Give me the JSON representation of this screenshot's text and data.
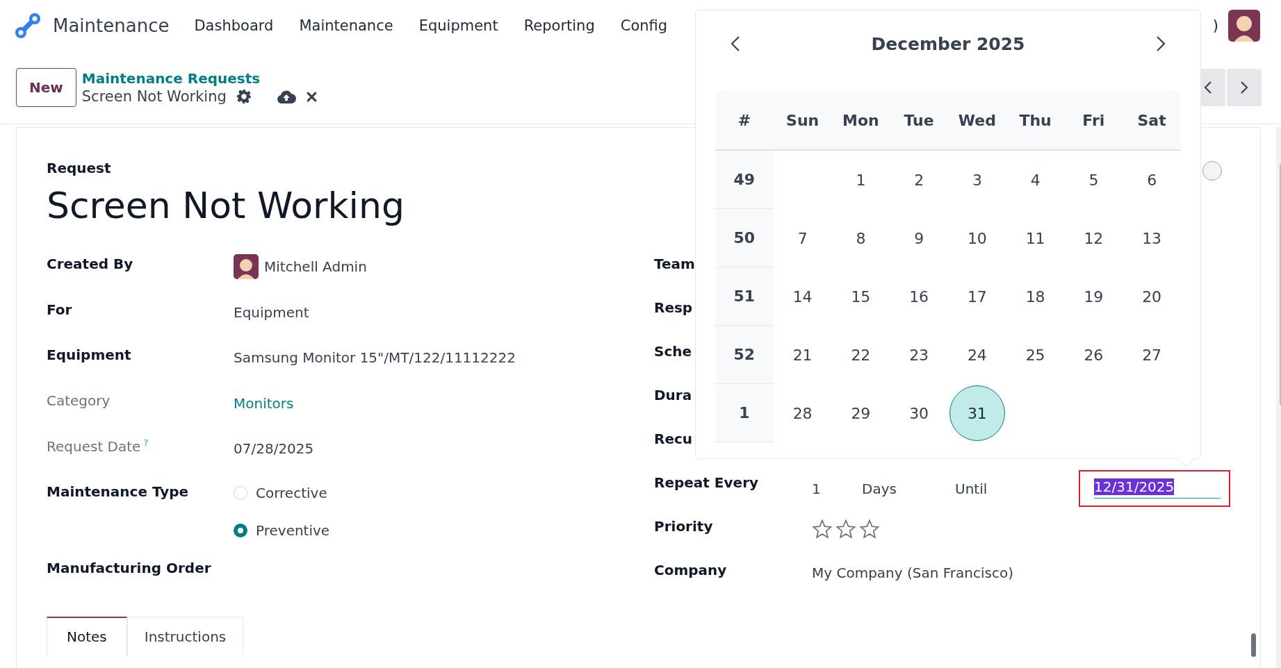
{
  "app_title": "Maintenance",
  "nav": [
    {
      "label": "Dashboard"
    },
    {
      "label": "Maintenance"
    },
    {
      "label": "Equipment"
    },
    {
      "label": "Reporting"
    },
    {
      "label": "Config"
    }
  ],
  "nav_fragment": ")",
  "new_button": "New",
  "breadcrumb": {
    "parent": "Maintenance Requests",
    "current": "Screen Not Working"
  },
  "form": {
    "title_label": "Request",
    "title": "Screen Not Working",
    "left": [
      {
        "kind": "user",
        "label": "Created By",
        "value": "Mitchell Admin",
        "muted": false
      },
      {
        "kind": "text",
        "label": "For",
        "value": "Equipment",
        "muted": false
      },
      {
        "kind": "text",
        "label": "Equipment",
        "value": "Samsung Monitor 15\"/MT/122/11112222",
        "muted": false
      },
      {
        "kind": "link",
        "label": "Category",
        "value": "Monitors",
        "muted": true
      },
      {
        "kind": "text",
        "label": "Request Date",
        "help": "?",
        "value": "07/28/2025",
        "muted": true
      },
      {
        "kind": "radio",
        "label": "Maintenance Type",
        "options": [
          {
            "label": "Corrective",
            "selected": false
          },
          {
            "label": "Preventive",
            "selected": true
          }
        ],
        "muted": false
      },
      {
        "kind": "empty",
        "label": "Manufacturing Order",
        "muted": false
      }
    ],
    "right": [
      {
        "kind": "hidden",
        "label": "Team"
      },
      {
        "kind": "hidden",
        "label": "Resp"
      },
      {
        "kind": "hidden",
        "label": "Sche"
      },
      {
        "kind": "hidden",
        "label": "Dura"
      },
      {
        "kind": "hidden",
        "label": "Recu"
      },
      {
        "kind": "repeat",
        "label": "Repeat Every",
        "value": "1",
        "unit": "Days",
        "until": "Until",
        "date": "12/31/2025"
      },
      {
        "kind": "stars",
        "label": "Priority",
        "stars": 0
      },
      {
        "kind": "text",
        "label": "Company",
        "value": "My Company (San Francisco)"
      }
    ],
    "tabs": [
      {
        "label": "Notes",
        "selected": true
      },
      {
        "label": "Instructions",
        "selected": false
      }
    ]
  },
  "calendar": {
    "title": "December 2025",
    "columns": [
      "#",
      "Sun",
      "Mon",
      "Tue",
      "Wed",
      "Thu",
      "Fri",
      "Sat"
    ],
    "weeks": [
      {
        "number": "49",
        "starts_midweek": true,
        "days": [
          {
            "label": "1",
            "selected": false
          },
          {
            "label": "2",
            "selected": false
          },
          {
            "label": "3",
            "selected": false
          },
          {
            "label": "4",
            "selected": false
          },
          {
            "label": "5",
            "selected": false
          },
          {
            "label": "6",
            "selected": false
          }
        ]
      },
      {
        "number": "50",
        "days": [
          {
            "label": "7",
            "selected": false
          },
          {
            "label": "8",
            "selected": false
          },
          {
            "label": "9",
            "selected": false
          },
          {
            "label": "10",
            "selected": false
          },
          {
            "label": "11",
            "selected": false
          },
          {
            "label": "12",
            "selected": false
          },
          {
            "label": "13",
            "selected": false
          }
        ]
      },
      {
        "number": "51",
        "days": [
          {
            "label": "14",
            "selected": false
          },
          {
            "label": "15",
            "selected": false
          },
          {
            "label": "16",
            "selected": false
          },
          {
            "label": "17",
            "selected": false
          },
          {
            "label": "18",
            "selected": false
          },
          {
            "label": "19",
            "selected": false
          },
          {
            "label": "20",
            "selected": false
          }
        ]
      },
      {
        "number": "52",
        "days": [
          {
            "label": "21",
            "selected": false
          },
          {
            "label": "22",
            "selected": false
          },
          {
            "label": "23",
            "selected": false
          },
          {
            "label": "24",
            "selected": false
          },
          {
            "label": "25",
            "selected": false
          },
          {
            "label": "26",
            "selected": false
          },
          {
            "label": "27",
            "selected": false
          }
        ]
      },
      {
        "number": "1",
        "starts_midweek": false,
        "days": [
          {
            "label": "28",
            "selected": false
          },
          {
            "label": "29",
            "selected": false
          },
          {
            "label": "30",
            "selected": false
          },
          {
            "label": "31",
            "selected": true
          }
        ]
      }
    ]
  }
}
